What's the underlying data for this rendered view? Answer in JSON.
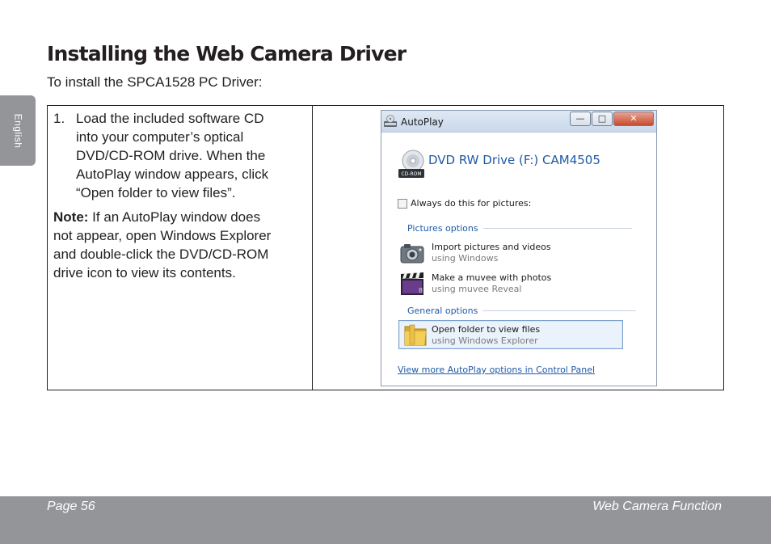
{
  "side_tab": {
    "label": "English"
  },
  "heading": {
    "title": "Installing the Web Camera Driver",
    "intro": "To install the SPCA1528 PC Driver:"
  },
  "step": {
    "number": "1.",
    "lines": [
      "Load the included software CD",
      "into your computer’s optical",
      "DVD/CD-ROM drive. When the",
      "AutoPlay window appears, click",
      "“Open folder to view files”."
    ]
  },
  "note": {
    "label": "Note:",
    "lines": [
      " If an AutoPlay window does",
      "not appear, open Windows Explorer",
      "and double-click the DVD/CD-ROM",
      "drive icon to view its contents."
    ]
  },
  "autoplay": {
    "title": "AutoPlay",
    "buttons": {
      "minimize": "—",
      "maximize": "□",
      "close": "✕"
    },
    "drive_title": "DVD RW Drive (F:) CAM4505",
    "drive_icon_label": "CD-ROM",
    "checkbox_label": "Always do this for pictures:",
    "pictures_section": "Pictures options",
    "options": [
      {
        "main": "Import pictures and videos",
        "sub": "using Windows",
        "icon": "camera-icon"
      },
      {
        "main": "Make a muvee with photos",
        "sub": "using muvee Reveal",
        "icon": "clapperboard-icon"
      }
    ],
    "general_section": "General options",
    "folder_option": {
      "main": "Open folder to view files",
      "sub": "using Windows Explorer",
      "icon": "folder-icon"
    },
    "control_panel_link": "View more AutoPlay options in Control Panel"
  },
  "footer": {
    "page": "Page 56",
    "section": "Web Camera Function"
  }
}
